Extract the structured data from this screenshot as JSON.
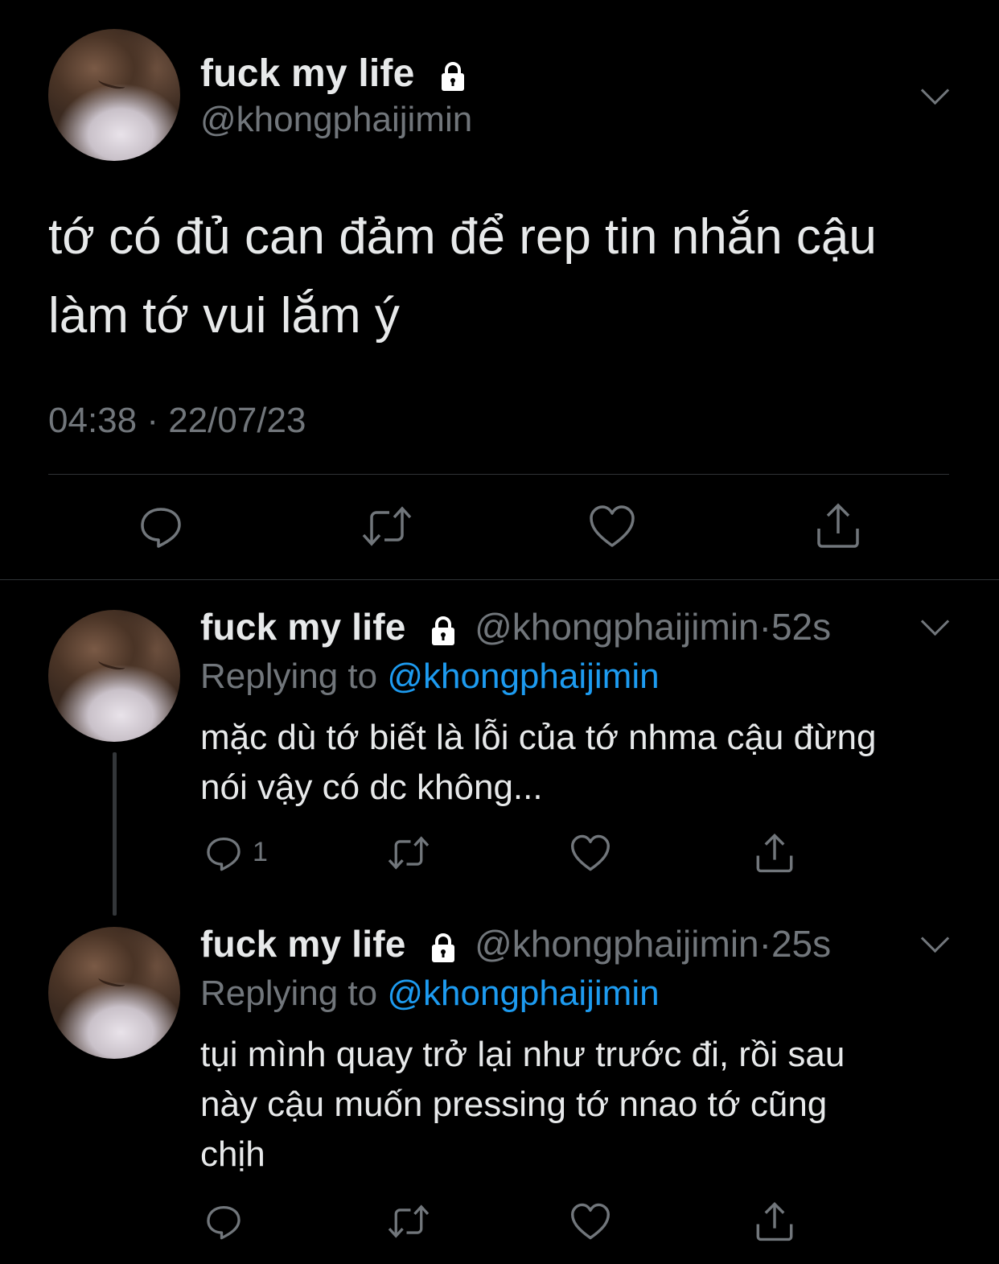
{
  "main_tweet": {
    "display_name": "fuck my life",
    "handle": "@khongphaijimin",
    "text_line1": "tớ có đủ can đảm để rep tin nhắn cậu",
    "text_line2": "làm tớ vui lắm ý",
    "timestamp": "04:38 · 22/07/23",
    "icons": {
      "reply": "reply-icon",
      "retweet": "retweet-icon",
      "like": "heart-icon",
      "share": "share-icon"
    }
  },
  "replies": [
    {
      "display_name": "fuck my life",
      "handle": "@khongphaijimin",
      "separator": "·",
      "time": "52s",
      "replying_label": "Replying to",
      "replying_to": "@khongphaijimin",
      "text_line1": "mặc dù tớ biết là lỗi của tớ nhma cậu đừng",
      "text_line2": "nói vậy có dc không...",
      "reply_count": "1"
    },
    {
      "display_name": "fuck my life",
      "handle": "@khongphaijimin",
      "separator": "·",
      "time": "25s",
      "replying_label": "Replying to",
      "replying_to": "@khongphaijimin",
      "text_line1": "tụi mình quay trở lại như trước đi, rồi sau",
      "text_line2": "này cậu muốn pressing tớ nnao tớ cũng",
      "text_line3": "chịh"
    }
  ],
  "colors": {
    "background": "#000000",
    "text": "#e7e9ea",
    "muted": "#71767b",
    "accent": "#1d9bf0",
    "divider": "#2f3336"
  }
}
